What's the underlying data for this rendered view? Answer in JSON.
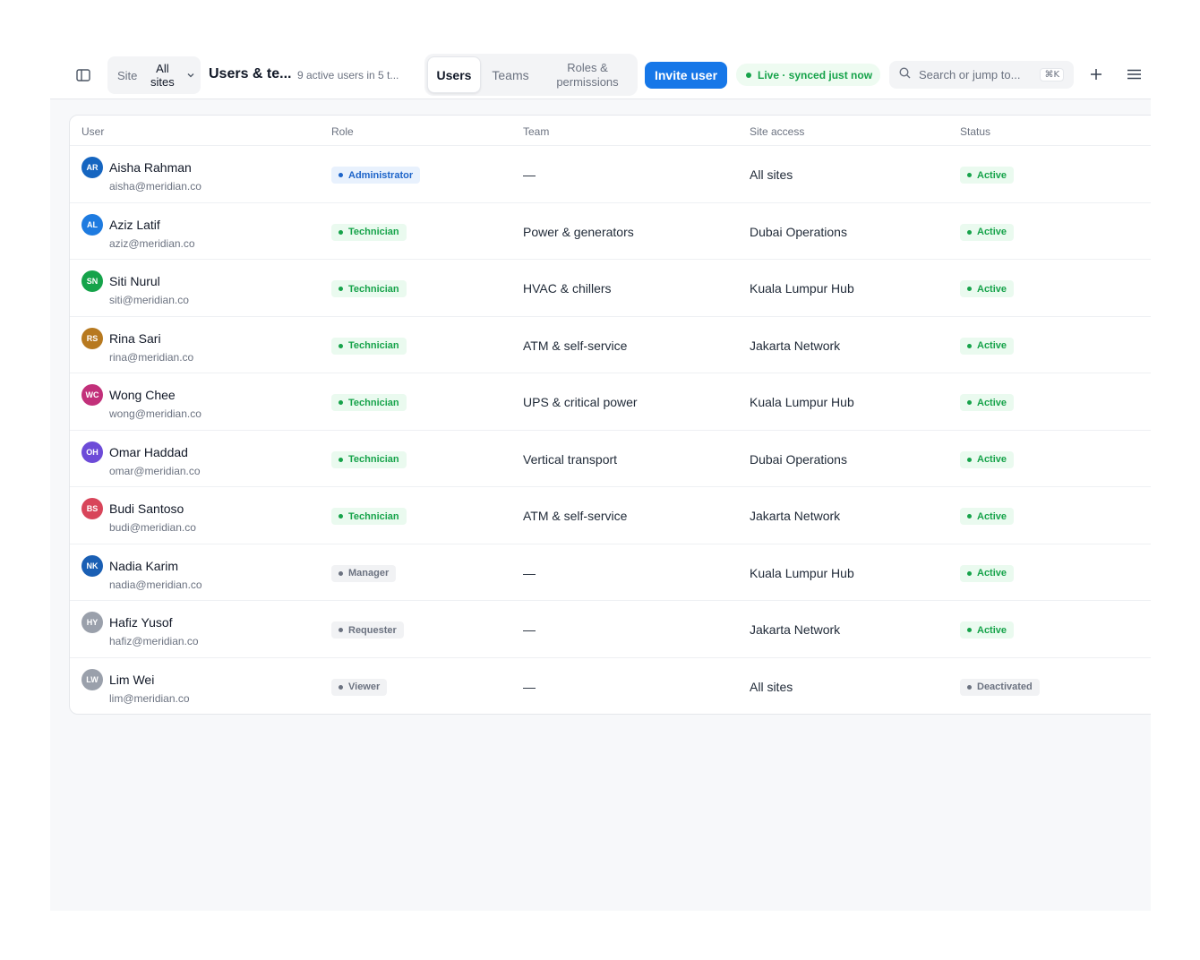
{
  "header": {
    "site_label": "Site",
    "site_value": "All sites",
    "title": "Users & te...",
    "subtitle": "9 active users in 5 t...",
    "tabs": [
      {
        "label": "Users"
      },
      {
        "label": "Teams"
      },
      {
        "label": "Roles & permissions"
      }
    ],
    "invite_label": "Invite user",
    "live_status": "Live · synced just now",
    "search_placeholder": "Search or jump to...",
    "search_shortcut": "⌘K"
  },
  "table": {
    "columns": [
      "User",
      "Role",
      "Team",
      "Site access",
      "Status"
    ],
    "rows": [
      {
        "initials": "AR",
        "avatar_color": "#1565c0",
        "name": "Aisha Rahman",
        "email": "aisha@meridian.co",
        "role": "Administrator",
        "role_style": "blue",
        "team": "—",
        "site": "All sites",
        "status": "Active",
        "status_style": "green"
      },
      {
        "initials": "AL",
        "avatar_color": "#1e7be0",
        "name": "Aziz Latif",
        "email": "aziz@meridian.co",
        "role": "Technician",
        "role_style": "green",
        "team": "Power & generators",
        "site": "Dubai Operations",
        "status": "Active",
        "status_style": "green"
      },
      {
        "initials": "SN",
        "avatar_color": "#15a34a",
        "name": "Siti Nurul",
        "email": "siti@meridian.co",
        "role": "Technician",
        "role_style": "green",
        "team": "HVAC & chillers",
        "site": "Kuala Lumpur Hub",
        "status": "Active",
        "status_style": "green"
      },
      {
        "initials": "RS",
        "avatar_color": "#b7791f",
        "name": "Rina Sari",
        "email": "rina@meridian.co",
        "role": "Technician",
        "role_style": "green",
        "team": "ATM & self-service",
        "site": "Jakarta Network",
        "status": "Active",
        "status_style": "green"
      },
      {
        "initials": "WC",
        "avatar_color": "#c2307a",
        "name": "Wong Chee",
        "email": "wong@meridian.co",
        "role": "Technician",
        "role_style": "green",
        "team": "UPS & critical power",
        "site": "Kuala Lumpur Hub",
        "status": "Active",
        "status_style": "green"
      },
      {
        "initials": "OH",
        "avatar_color": "#6d4bd8",
        "name": "Omar Haddad",
        "email": "omar@meridian.co",
        "role": "Technician",
        "role_style": "green",
        "team": "Vertical transport",
        "site": "Dubai Operations",
        "status": "Active",
        "status_style": "green"
      },
      {
        "initials": "BS",
        "avatar_color": "#d8455a",
        "name": "Budi Santoso",
        "email": "budi@meridian.co",
        "role": "Technician",
        "role_style": "green",
        "team": "ATM & self-service",
        "site": "Jakarta Network",
        "status": "Active",
        "status_style": "green"
      },
      {
        "initials": "NK",
        "avatar_color": "#1a5fb4",
        "name": "Nadia Karim",
        "email": "nadia@meridian.co",
        "role": "Manager",
        "role_style": "gray",
        "team": "—",
        "site": "Kuala Lumpur Hub",
        "status": "Active",
        "status_style": "green"
      },
      {
        "initials": "HY",
        "avatar_color": "#9aa0ab",
        "name": "Hafiz Yusof",
        "email": "hafiz@meridian.co",
        "role": "Requester",
        "role_style": "gray",
        "team": "—",
        "site": "Jakarta Network",
        "status": "Active",
        "status_style": "green"
      },
      {
        "initials": "LW",
        "avatar_color": "#9aa0ab",
        "name": "Lim Wei",
        "email": "lim@meridian.co",
        "role": "Viewer",
        "role_style": "gray",
        "team": "—",
        "site": "All sites",
        "status": "Deactivated",
        "status_style": "gray"
      }
    ]
  }
}
